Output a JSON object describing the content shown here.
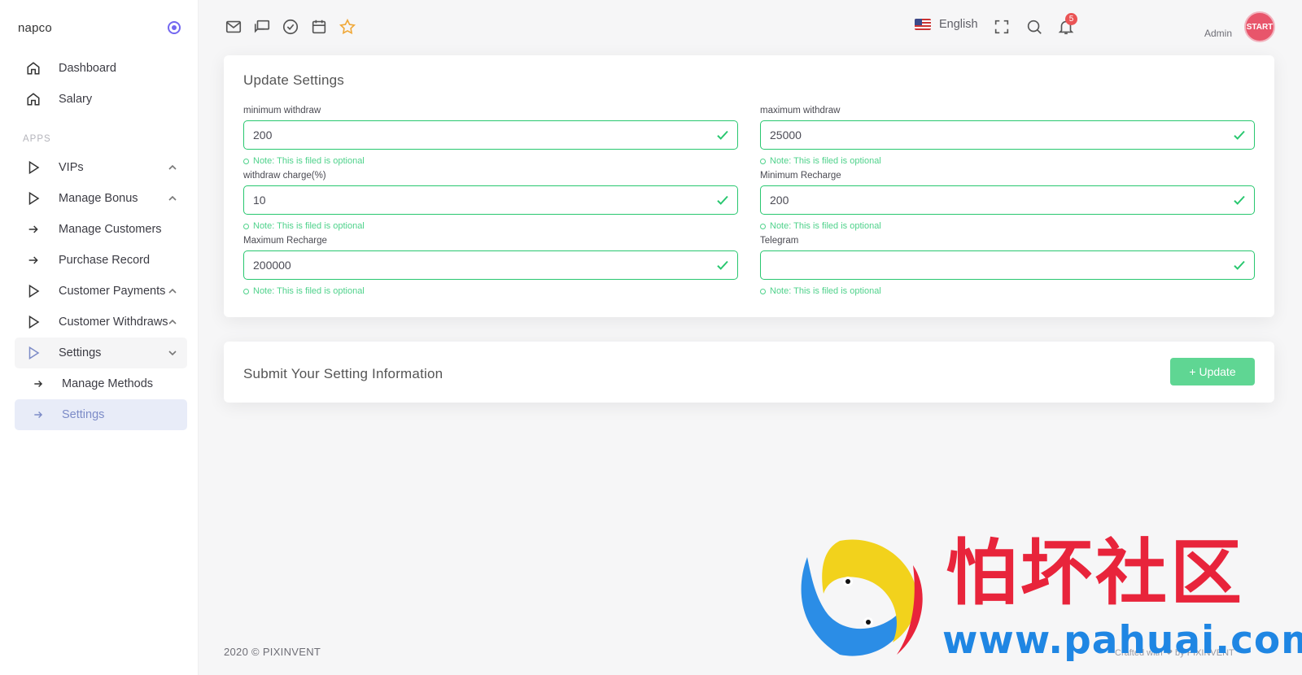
{
  "sidebar": {
    "brand": "napco",
    "section_label": "APPS",
    "items": [
      {
        "label": "Dashboard"
      },
      {
        "label": "Salary"
      },
      {
        "label": "VIPs"
      },
      {
        "label": "Manage Bonus"
      },
      {
        "label": "Manage Customers"
      },
      {
        "label": "Purchase Record"
      },
      {
        "label": "Customer Payments"
      },
      {
        "label": "Customer Withdraws"
      },
      {
        "label": "Settings"
      },
      {
        "label": "Manage Methods"
      },
      {
        "label": "Settings"
      }
    ]
  },
  "topbar": {
    "language": "English",
    "notification_count": "5",
    "user_role": "Admin",
    "avatar_text": "START"
  },
  "settings_card": {
    "title": "Update Settings",
    "fields": [
      {
        "label": "minimum withdraw",
        "value": "200",
        "note": "Note: This is filed is optional"
      },
      {
        "label": "maximum withdraw",
        "value": "25000",
        "note": "Note: This is filed is optional"
      },
      {
        "label": "withdraw charge(%)",
        "value": "10",
        "note": "Note: This is filed is optional"
      },
      {
        "label": "Minimum Recharge",
        "value": "200",
        "note": "Note: This is filed is optional"
      },
      {
        "label": "Maximum Recharge",
        "value": "200000",
        "note": "Note: This is filed is optional"
      },
      {
        "label": "Telegram",
        "value": "",
        "note": "Note: This is filed is optional"
      }
    ]
  },
  "submit_card": {
    "title": "Submit Your Setting Information",
    "button_label": "+ Update"
  },
  "footer": {
    "copyright": "2020 © PIXINVENT",
    "right_text": "Crafted with ❤ by PIXINVENT"
  },
  "watermark": {
    "chinese": "怕坏社区",
    "url": "www.pahuai.com"
  },
  "colors": {
    "accent": "#7367f0",
    "success": "#28c76f",
    "button": "#5fd693",
    "badge": "#ea5455",
    "active_bg": "#e8ecf8"
  },
  "icons": [
    "mail-icon",
    "chat-icon",
    "check-circle-icon",
    "calendar-icon",
    "star-icon",
    "fullscreen-icon",
    "search-icon",
    "bell-icon"
  ]
}
